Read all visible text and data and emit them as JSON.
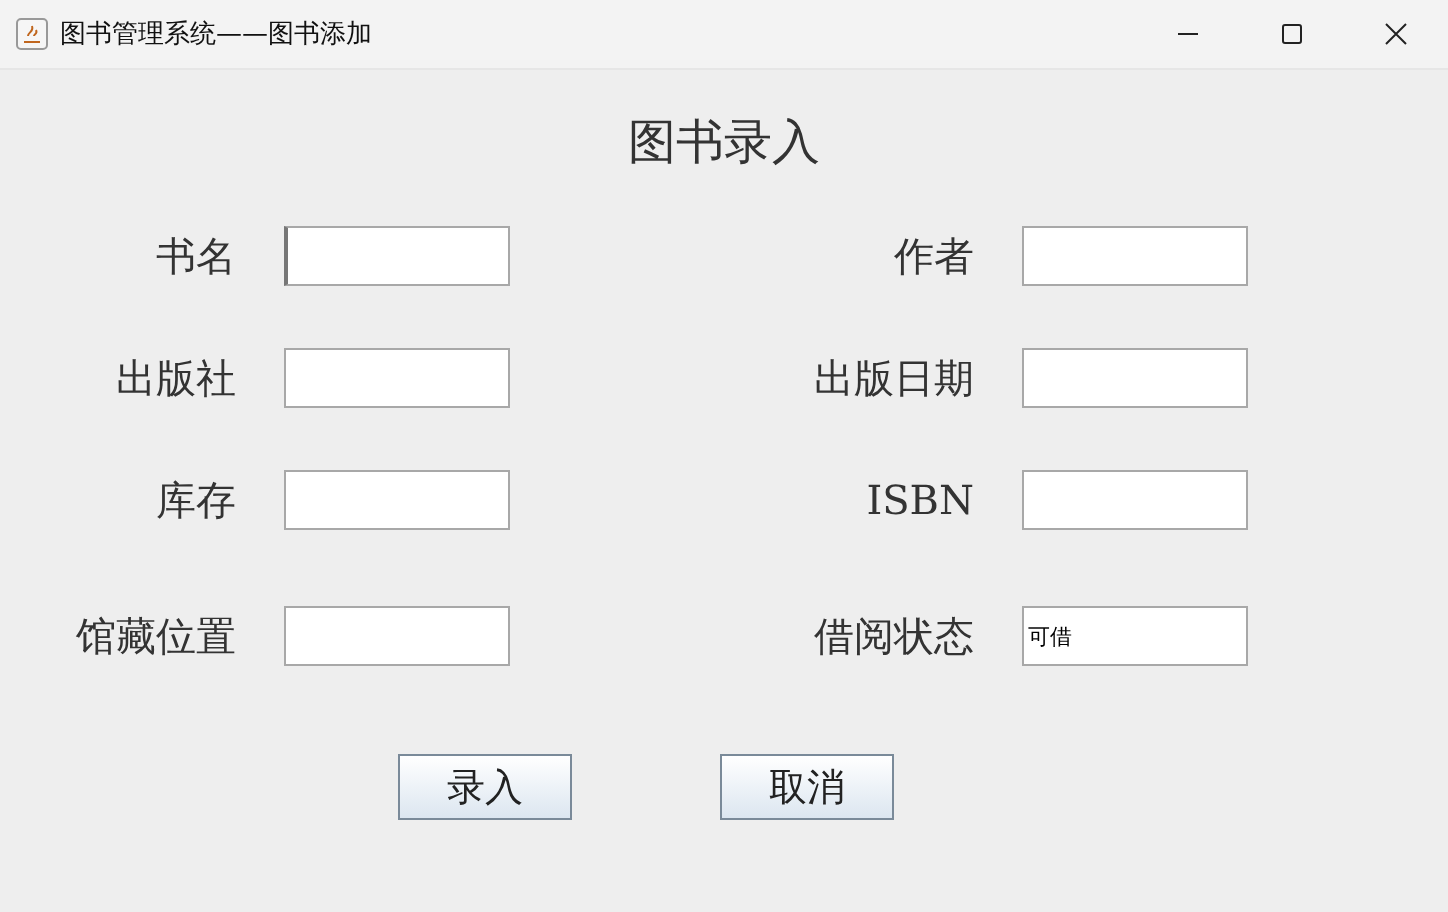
{
  "window": {
    "title": "图书管理系统——图书添加"
  },
  "heading": "图书录入",
  "fields": [
    {
      "label": "书名",
      "focused": true
    },
    {
      "label": "作者",
      "focused": false
    },
    {
      "label": "出版社",
      "focused": false
    },
    {
      "label": "出版日期",
      "focused": false
    },
    {
      "label": "库存",
      "focused": false
    },
    {
      "label": "ISBN",
      "focused": false
    },
    {
      "label": "馆藏位置",
      "focused": false
    },
    {
      "label": "借阅状态",
      "value": "可借",
      "focused": false
    }
  ],
  "buttons": [
    "录入",
    "取消"
  ]
}
